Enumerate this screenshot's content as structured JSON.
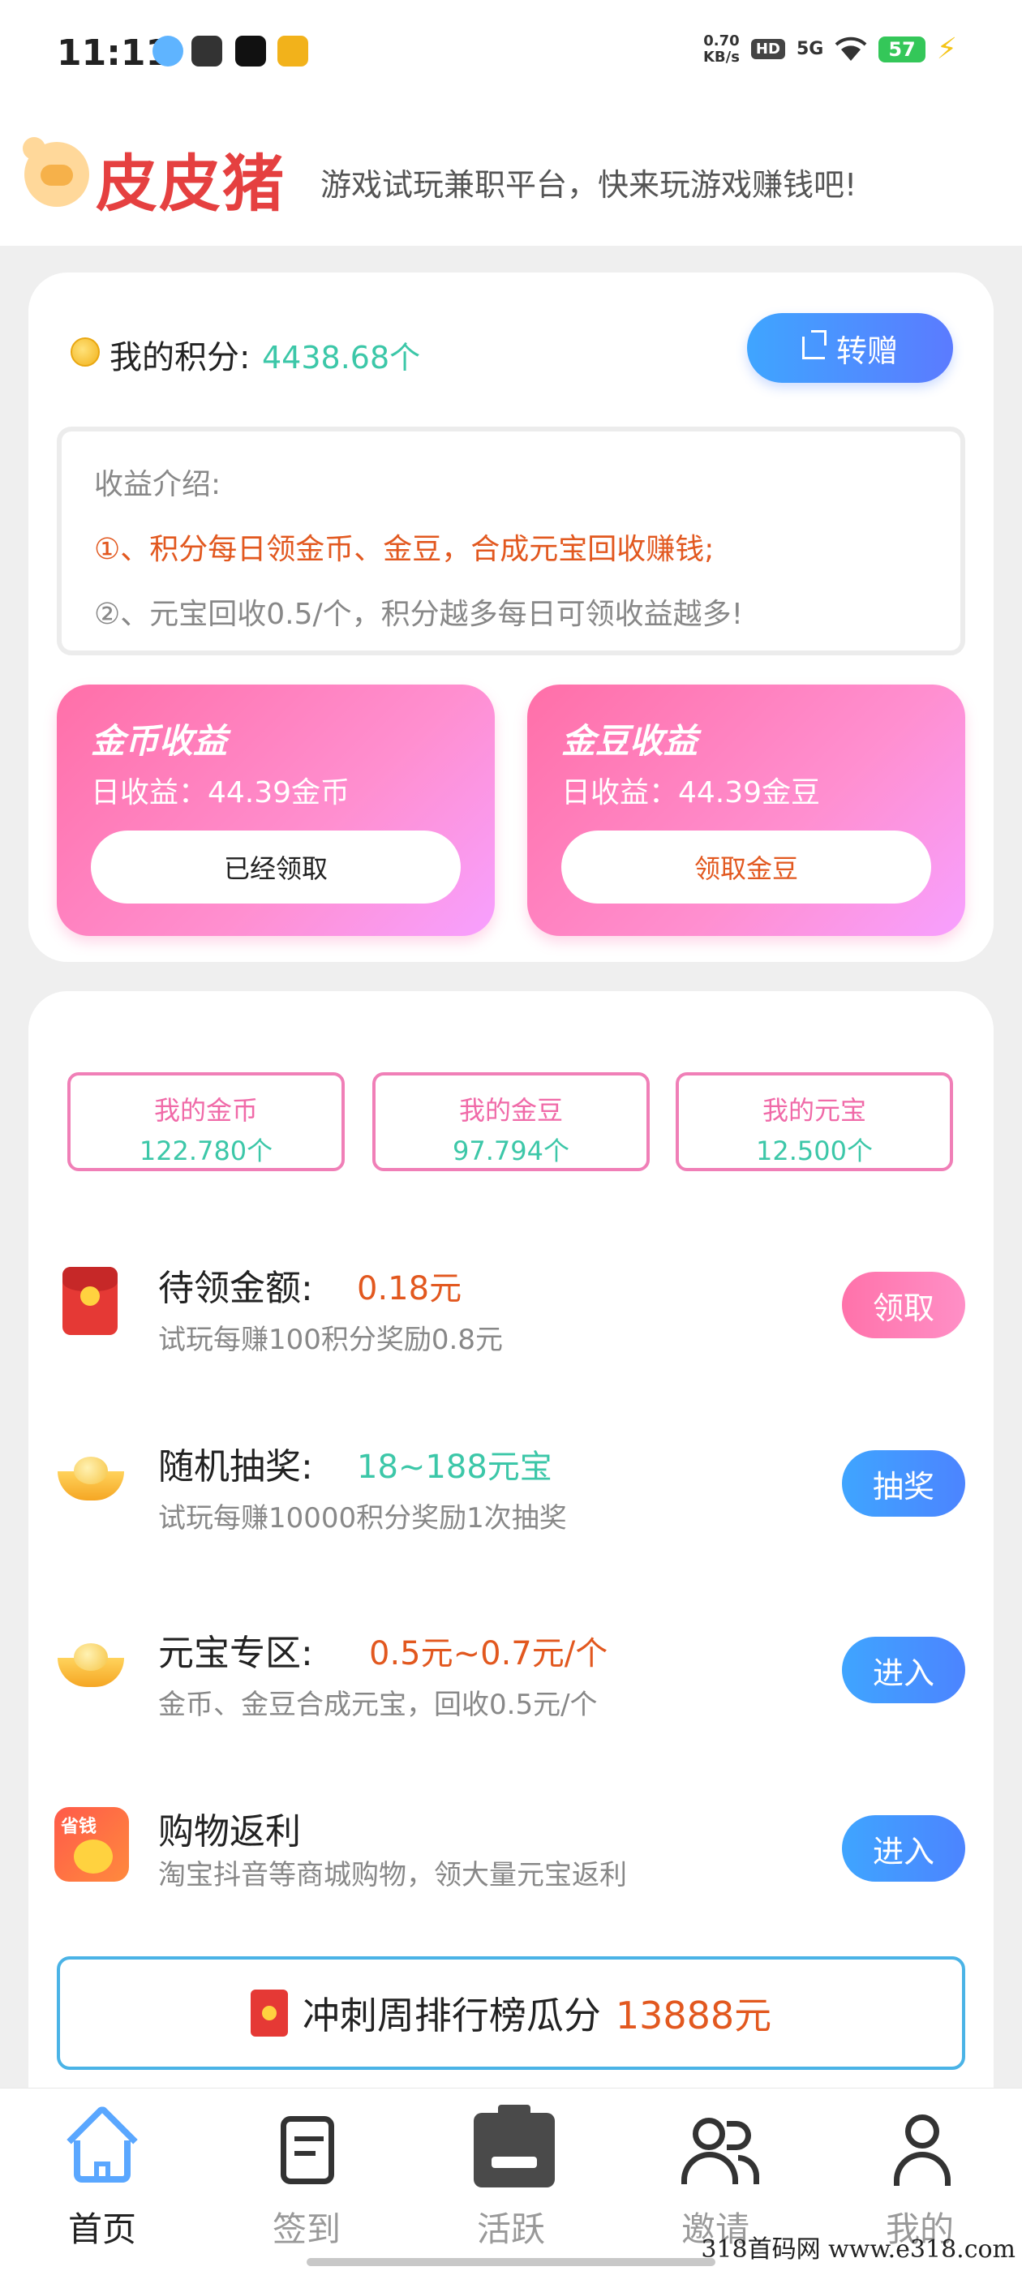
{
  "status_bar": {
    "time": "11:11",
    "net_speed_value": "0.70",
    "net_speed_unit": "KB/s",
    "hd": "HD",
    "network": "5G",
    "battery": "57"
  },
  "header": {
    "brand": "皮皮猪",
    "slogan": "游戏试玩兼职平台，快来玩游戏赚钱吧!"
  },
  "points": {
    "label": "我的积分:",
    "value": "4438.68个",
    "gift_button": "转赠"
  },
  "intro": {
    "title": "收益介绍:",
    "line1": "①、积分每日领金币、金豆，合成元宝回收赚钱;",
    "line2": "②、元宝回收0.5/个，积分越多每日可领收益越多!"
  },
  "earnings": [
    {
      "title": "金币收益",
      "daily": "日收益：44.39金币",
      "button": "已经领取",
      "button_color": "#222222"
    },
    {
      "title": "金豆收益",
      "daily": "日收益：44.39金豆",
      "button": "领取金豆",
      "button_color": "#e2581f"
    }
  ],
  "assets": [
    {
      "name": "我的金币",
      "value": "122.780个"
    },
    {
      "name": "我的金豆",
      "value": "97.794个"
    },
    {
      "name": "我的元宝",
      "value": "12.500个"
    }
  ],
  "rows": [
    {
      "icon": "red-packet-icon",
      "title": "待领金额:",
      "value": "0.18元",
      "value_color": "#e2581f",
      "desc": "试玩每赚100积分奖励0.8元",
      "button": "领取"
    },
    {
      "icon": "gold-ingot-icon",
      "title": "随机抽奖:",
      "value": "18~188元宝",
      "value_color": "#3cc7a8",
      "desc": "试玩每赚10000积分奖励1次抽奖",
      "button": "抽奖"
    },
    {
      "icon": "gold-ingot-icon",
      "title": "元宝专区:",
      "value": "0.5元~0.7元/个",
      "value_color": "#e2581f",
      "desc": "金币、金豆合成元宝，回收0.5元/个",
      "button": "进入"
    },
    {
      "icon": "shopping-icon",
      "title": "购物返利",
      "value": "",
      "desc": "淘宝抖音等商城购物，领大量元宝返利",
      "button": "进入",
      "shop_tag": "省钱"
    }
  ],
  "rank_banner": {
    "text": "冲刺周排行榜瓜分",
    "amount": "13888元"
  },
  "nav": [
    {
      "label": "首页",
      "icon": "home-icon",
      "active": true
    },
    {
      "label": "签到",
      "icon": "sign-in-icon",
      "active": false
    },
    {
      "label": "活跃",
      "icon": "activity-icon",
      "active": false
    },
    {
      "label": "邀请",
      "icon": "invite-icon",
      "active": false
    },
    {
      "label": "我的",
      "icon": "profile-icon",
      "active": false
    }
  ],
  "watermark": "318首码网 www.e318.com",
  "colors": {
    "accent_blue": "#3fa5ff",
    "accent_pink": "#ff72aa",
    "brand_red": "#e54040",
    "highlight_orange": "#e2581f",
    "highlight_teal": "#3cc7a8"
  }
}
